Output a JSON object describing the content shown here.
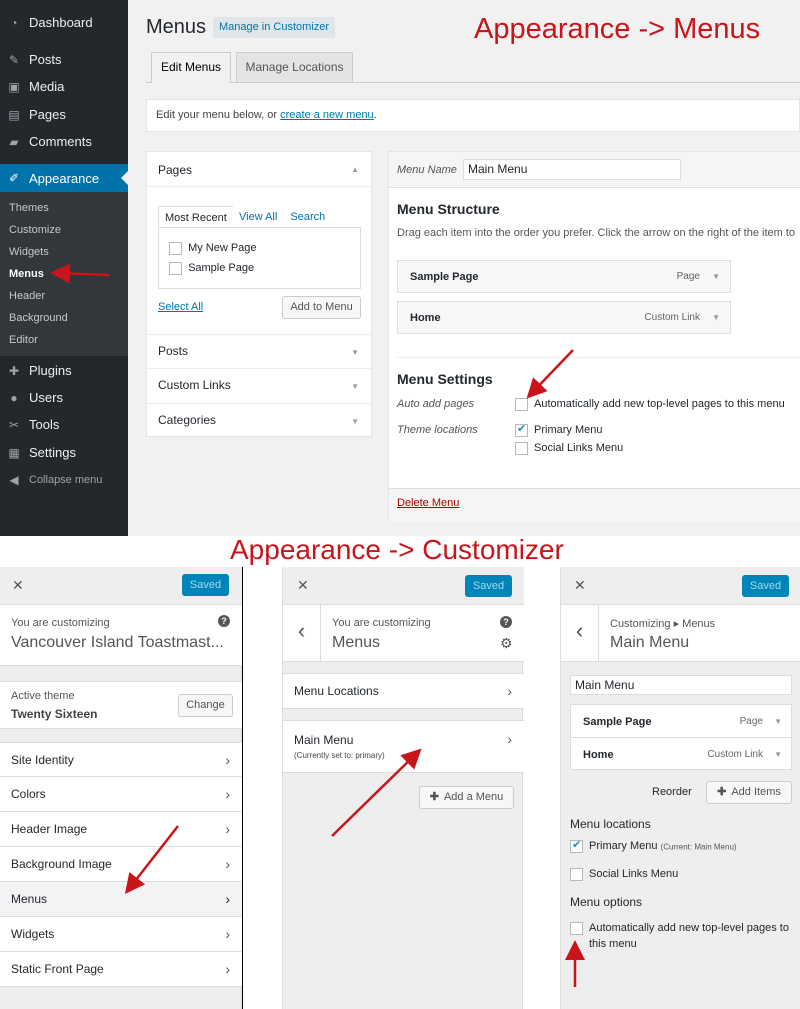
{
  "admin": {
    "sidebar": {
      "items": [
        {
          "label": "Dashboard",
          "icon": "dashboard-icon"
        },
        {
          "label": "Posts",
          "icon": "pin-icon"
        },
        {
          "label": "Media",
          "icon": "media-icon"
        },
        {
          "label": "Pages",
          "icon": "pages-icon"
        },
        {
          "label": "Comments",
          "icon": "comments-icon"
        },
        {
          "label": "Appearance",
          "icon": "appearance-icon"
        },
        {
          "label": "Plugins",
          "icon": "plugins-icon"
        },
        {
          "label": "Users",
          "icon": "users-icon"
        },
        {
          "label": "Tools",
          "icon": "tools-icon"
        },
        {
          "label": "Settings",
          "icon": "settings-icon"
        },
        {
          "label": "Collapse menu",
          "icon": "collapse-icon"
        }
      ],
      "submenu": [
        "Themes",
        "Customize",
        "Widgets",
        "Menus",
        "Header",
        "Background",
        "Editor"
      ]
    },
    "title": "Menus",
    "manage_customizer": "Manage in Customizer",
    "tabs": [
      "Edit Menus",
      "Manage Locations"
    ],
    "notice_prefix": "Edit your menu below, or ",
    "notice_link": "create a new menu",
    "notice_suffix": ".",
    "pages_box": {
      "title": "Pages",
      "tabs": [
        "Most Recent",
        "View All",
        "Search"
      ],
      "items": [
        "My New Page",
        "Sample Page"
      ],
      "select_all": "Select All",
      "add_button": "Add to Menu"
    },
    "accordion": [
      "Posts",
      "Custom Links",
      "Categories"
    ],
    "menu_name_label": "Menu Name",
    "menu_name_value": "Main Menu",
    "structure_title": "Menu Structure",
    "structure_desc": "Drag each item into the order you prefer. Click the arrow on the right of the item to",
    "menu_items": [
      {
        "label": "Sample Page",
        "type": "Page"
      },
      {
        "label": "Home",
        "type": "Custom Link"
      }
    ],
    "settings_title": "Menu Settings",
    "auto_add_label": "Auto add pages",
    "auto_add_text": "Automatically add new top-level pages to this menu",
    "theme_locations_label": "Theme locations",
    "locations": [
      {
        "label": "Primary Menu",
        "checked": true
      },
      {
        "label": "Social Links Menu",
        "checked": false
      }
    ],
    "delete_link": "Delete Menu"
  },
  "annotations": {
    "top": "Appearance -> Menus",
    "bottom": "Appearance -> Customizer"
  },
  "customizer1": {
    "close": "✕",
    "saved": "Saved",
    "customizing": "You are customizing",
    "site": "Vancouver Island Toastmast...",
    "help": "?",
    "active_theme_label": "Active theme",
    "theme_name": "Twenty Sixteen",
    "change": "Change",
    "sections": [
      "Site Identity",
      "Colors",
      "Header Image",
      "Background Image",
      "Menus",
      "Widgets",
      "Static Front Page"
    ]
  },
  "customizer2": {
    "close": "✕",
    "saved": "Saved",
    "back": "‹",
    "customizing": "You are customizing",
    "title": "Menus",
    "help": "?",
    "gear": "⚙",
    "locations": "Menu Locations",
    "main_menu": "Main Menu",
    "main_menu_sub": "(Currently set to: primary)",
    "add_menu": "Add a Menu"
  },
  "customizer3": {
    "close": "✕",
    "saved": "Saved",
    "back": "‹",
    "crumb": "Customizing ▸ Menus",
    "title": "Main Menu",
    "name_value": "Main Menu",
    "items": [
      {
        "label": "Sample Page",
        "type": "Page"
      },
      {
        "label": "Home",
        "type": "Custom Link"
      }
    ],
    "reorder": "Reorder",
    "add_items": "Add Items",
    "locations_title": "Menu locations",
    "loc_primary": "Primary Menu",
    "loc_primary_note": "(Current: Main Menu)",
    "loc_social": "Social Links Menu",
    "options_title": "Menu options",
    "auto_add": "Automatically add new top-level pages to",
    "auto_add2": "this menu"
  },
  "colors": {
    "accent": "#0073aa",
    "arrow": "#c9141a",
    "sidebar": "#23282d"
  }
}
